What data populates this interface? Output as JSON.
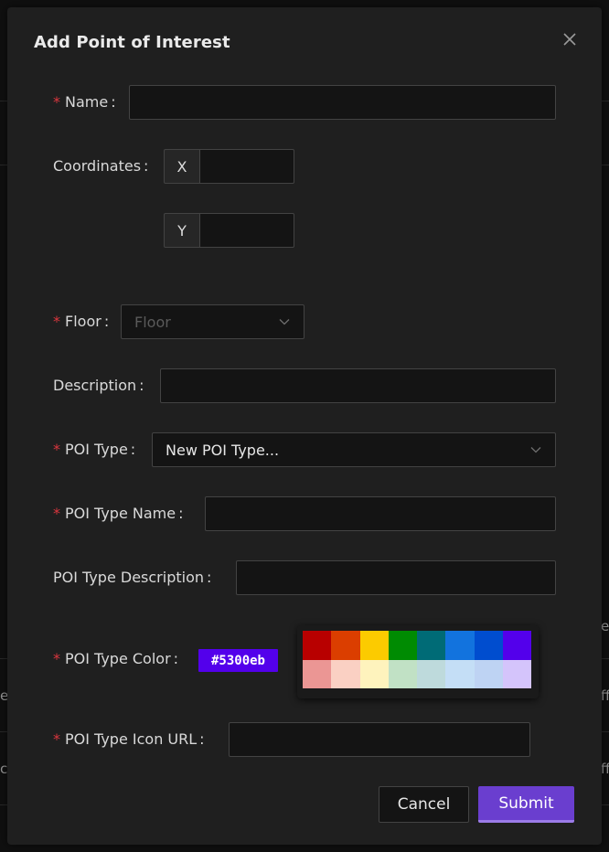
{
  "background": {
    "fragments": [
      "e",
      "ff",
      "ch",
      "ff",
      "e"
    ]
  },
  "modal": {
    "title": "Add Point of Interest",
    "close_icon": "close-icon"
  },
  "form": {
    "name": {
      "label": "Name",
      "value": ""
    },
    "coordinates": {
      "label": "Coordinates",
      "x_addon": "X",
      "y_addon": "Y",
      "x_value": "",
      "y_value": ""
    },
    "floor": {
      "label": "Floor",
      "placeholder": "Floor"
    },
    "description": {
      "label": "Description",
      "value": ""
    },
    "poi_type": {
      "label": "POI Type",
      "selected": "New POI Type..."
    },
    "poi_type_name": {
      "label": "POI Type Name",
      "value": ""
    },
    "poi_type_description": {
      "label": "POI Type Description",
      "value": ""
    },
    "poi_type_color": {
      "label": "POI Type Color",
      "value": "#5300eb",
      "palette": [
        "#b80000",
        "#db3e00",
        "#fccb00",
        "#008b02",
        "#006b76",
        "#1273de",
        "#004dcf",
        "#5300eb",
        "#eb9694",
        "#fad0c3",
        "#fef3bd",
        "#c1e1c5",
        "#bedadc",
        "#c4def6",
        "#bed3f3",
        "#d4c4fb"
      ]
    },
    "poi_type_icon_url": {
      "label": "POI Type Icon URL",
      "value": ""
    },
    "required_mark": "*",
    "colon": ":"
  },
  "actions": {
    "cancel_label": "Cancel",
    "submit_label": "Submit"
  },
  "colors": {
    "accent": "#6a3ecf",
    "required": "#d9363e"
  }
}
